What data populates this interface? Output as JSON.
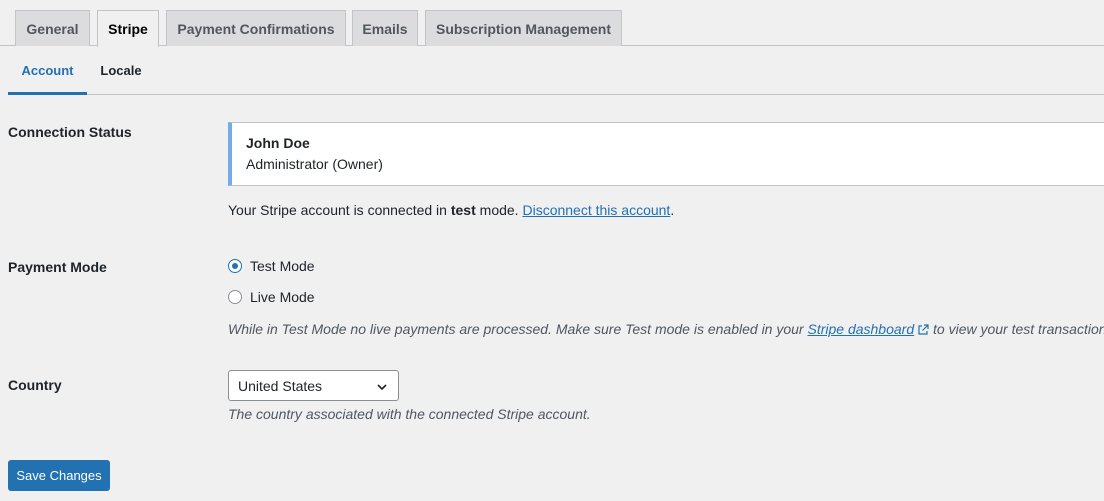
{
  "tabs": [
    {
      "label": "General"
    },
    {
      "label": "Stripe",
      "active": true
    },
    {
      "label": "Payment Confirmations"
    },
    {
      "label": "Emails"
    },
    {
      "label": "Subscription Management"
    }
  ],
  "subtabs": [
    {
      "label": "Account",
      "active": true
    },
    {
      "label": "Locale"
    }
  ],
  "connection": {
    "label": "Connection Status",
    "name": "John Doe",
    "role": "Administrator (Owner)",
    "status_prefix": "Your Stripe account is connected in ",
    "status_mode": "test",
    "status_suffix": " mode. ",
    "disconnect_link": "Disconnect this account",
    "status_end": "."
  },
  "payment_mode": {
    "label": "Payment Mode",
    "options": [
      {
        "label": "Test Mode",
        "checked": true
      },
      {
        "label": "Live Mode",
        "checked": false
      }
    ],
    "desc_prefix": "While in Test Mode no live payments are processed. Make sure Test mode is enabled in your ",
    "dashboard_link": "Stripe dashboard",
    "desc_suffix": " to view your test transactions."
  },
  "country": {
    "label": "Country",
    "selected": "United States",
    "desc": "The country associated with the connected Stripe account."
  },
  "save_label": "Save Changes",
  "colors": {
    "accent": "#2271b1",
    "card_border": "#72aee6"
  },
  "icons": [
    "external-link-icon",
    "chevron-down-icon"
  ]
}
